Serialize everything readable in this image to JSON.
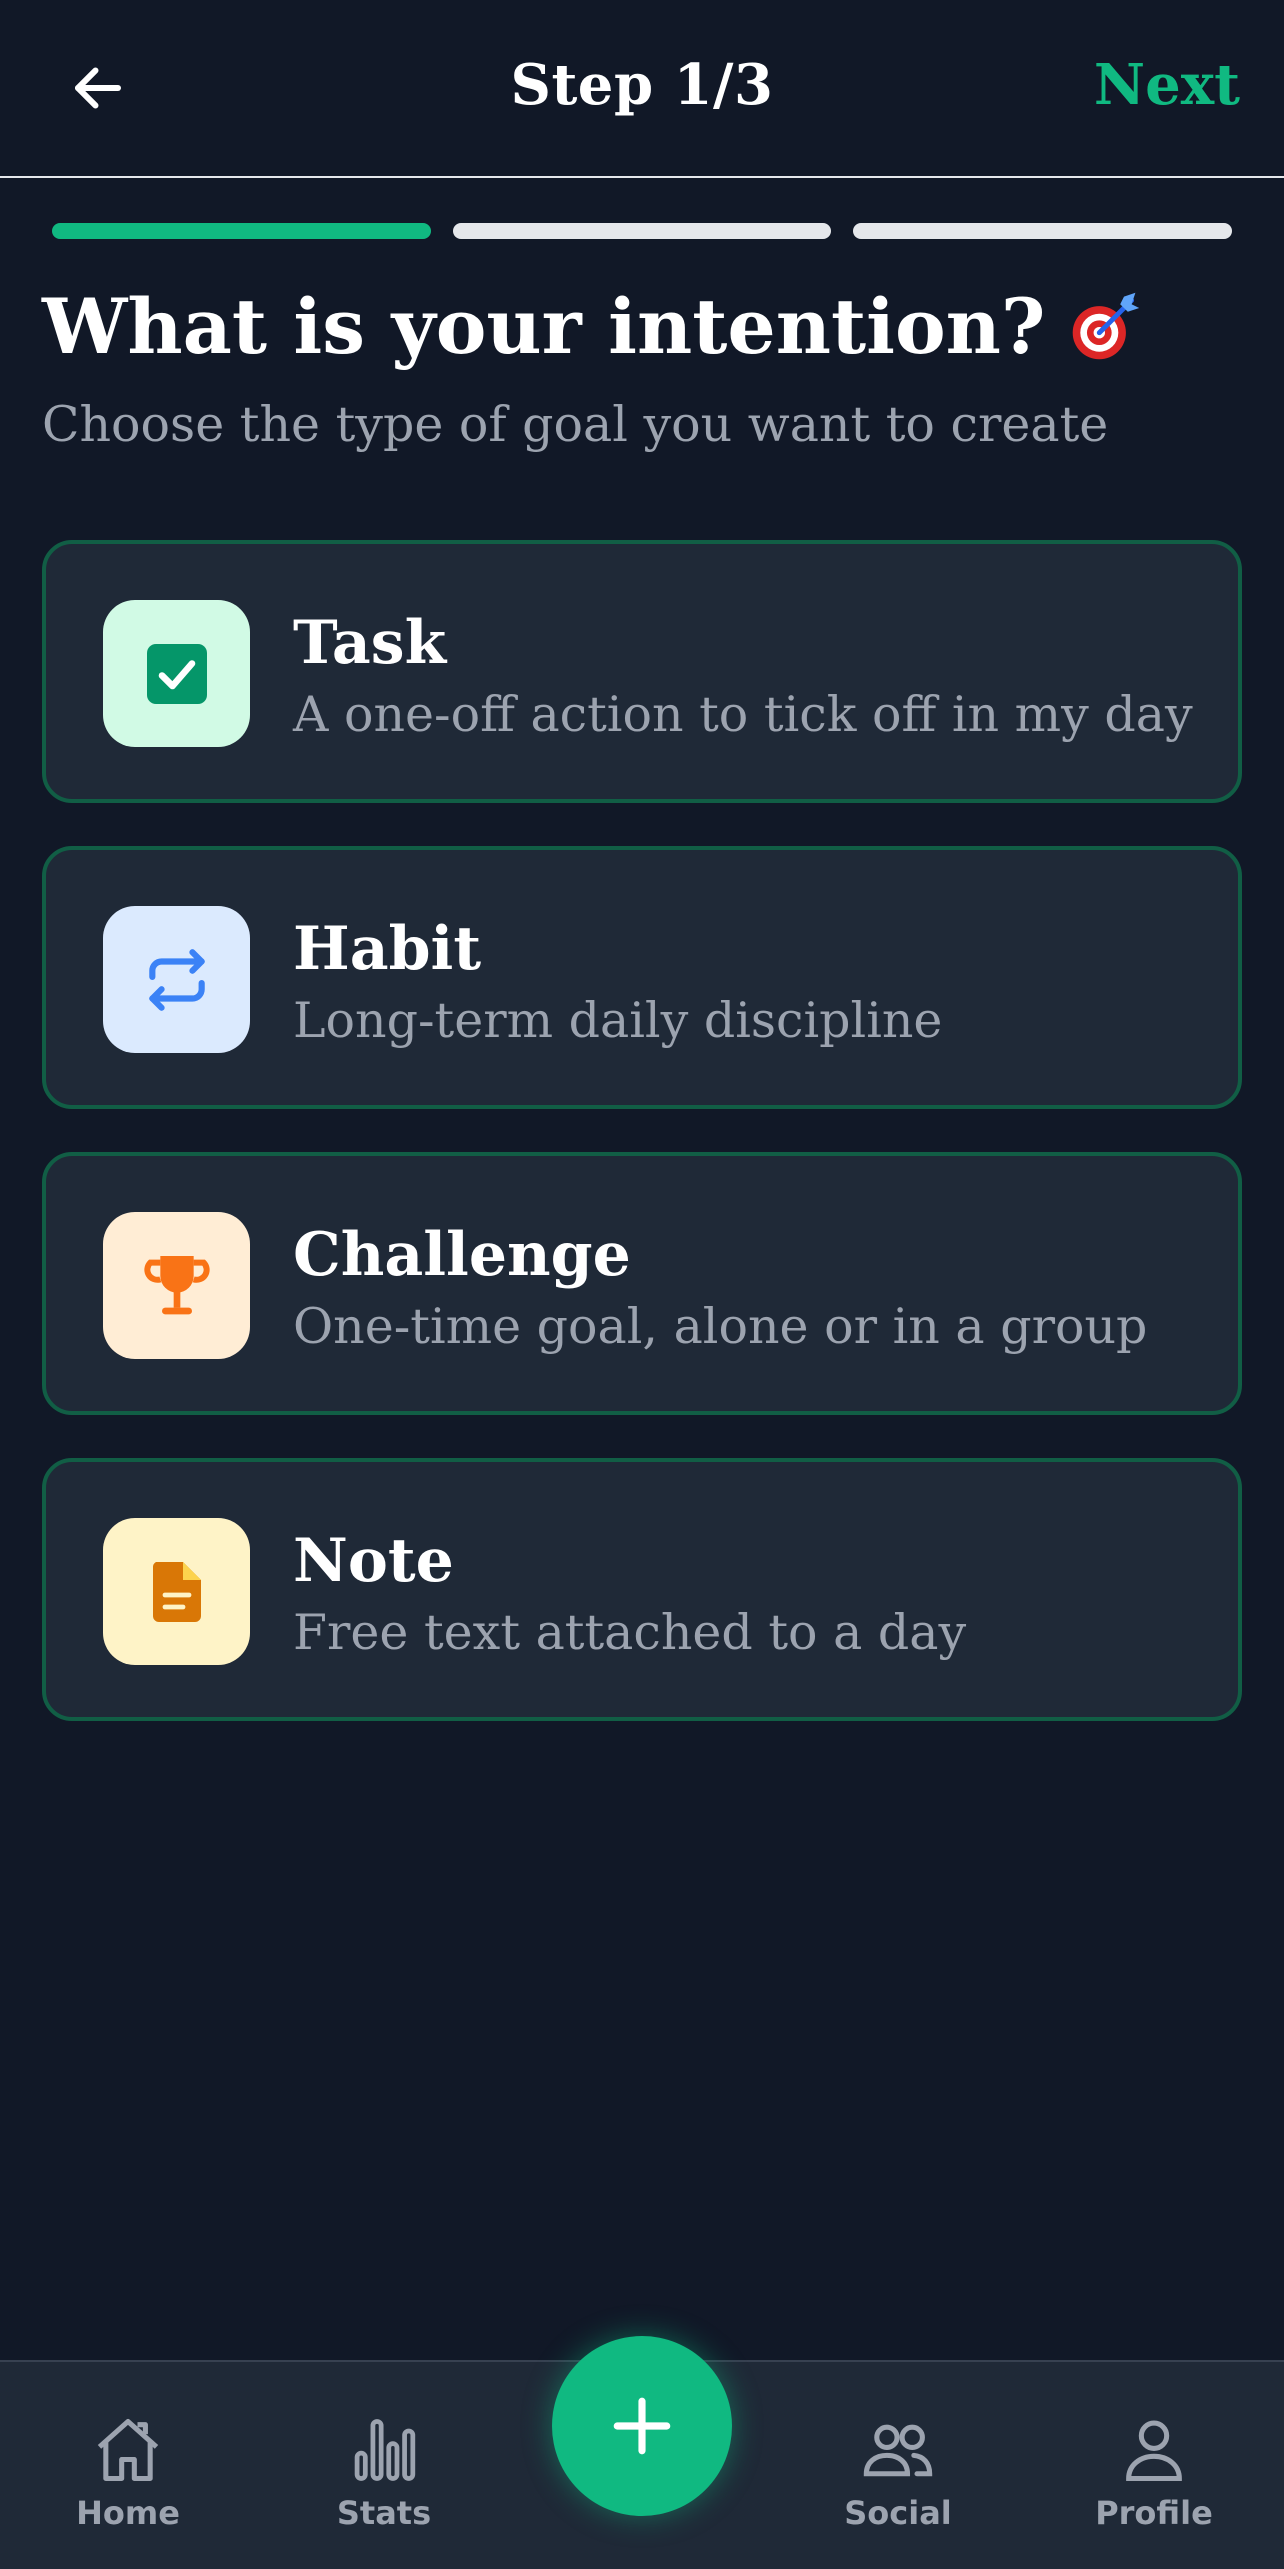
{
  "header": {
    "title": "Step 1/3",
    "next_label": "Next",
    "back_icon": "arrow-left-icon"
  },
  "progress": {
    "current_step": 1,
    "total_steps": 3,
    "active_color": "#10b981"
  },
  "main": {
    "title": "What is your intention?",
    "title_icon": "target-icon",
    "subtitle": "Choose the type of goal you want to create"
  },
  "options": [
    {
      "title": "Task",
      "description": "A one-off action to tick off in my day",
      "icon": "checkbox-icon",
      "icon_bg": "#d1fae5",
      "icon_color": "#059669"
    },
    {
      "title": "Habit",
      "description": "Long-term daily discipline",
      "icon": "repeat-icon",
      "icon_bg": "#dbeafe",
      "icon_color": "#3b82f6"
    },
    {
      "title": "Challenge",
      "description": "One-time goal, alone or in a group",
      "icon": "trophy-icon",
      "icon_bg": "#ffedd5",
      "icon_color": "#f97316"
    },
    {
      "title": "Note",
      "description": "Free text attached to a day",
      "icon": "document-icon",
      "icon_bg": "#fef3c7",
      "icon_color": "#d97706"
    }
  ],
  "bottom_nav": {
    "items": [
      {
        "label": "Home",
        "icon": "home-icon"
      },
      {
        "label": "Stats",
        "icon": "bar-chart-icon"
      },
      {
        "label": "Social",
        "icon": "users-icon"
      },
      {
        "label": "Profile",
        "icon": "user-icon"
      }
    ],
    "fab_icon": "plus-icon"
  },
  "colors": {
    "background": "#111827",
    "card": "#1f2937",
    "card_border": "#115e45",
    "accent": "#10b981",
    "muted_text": "#9ca3af"
  }
}
